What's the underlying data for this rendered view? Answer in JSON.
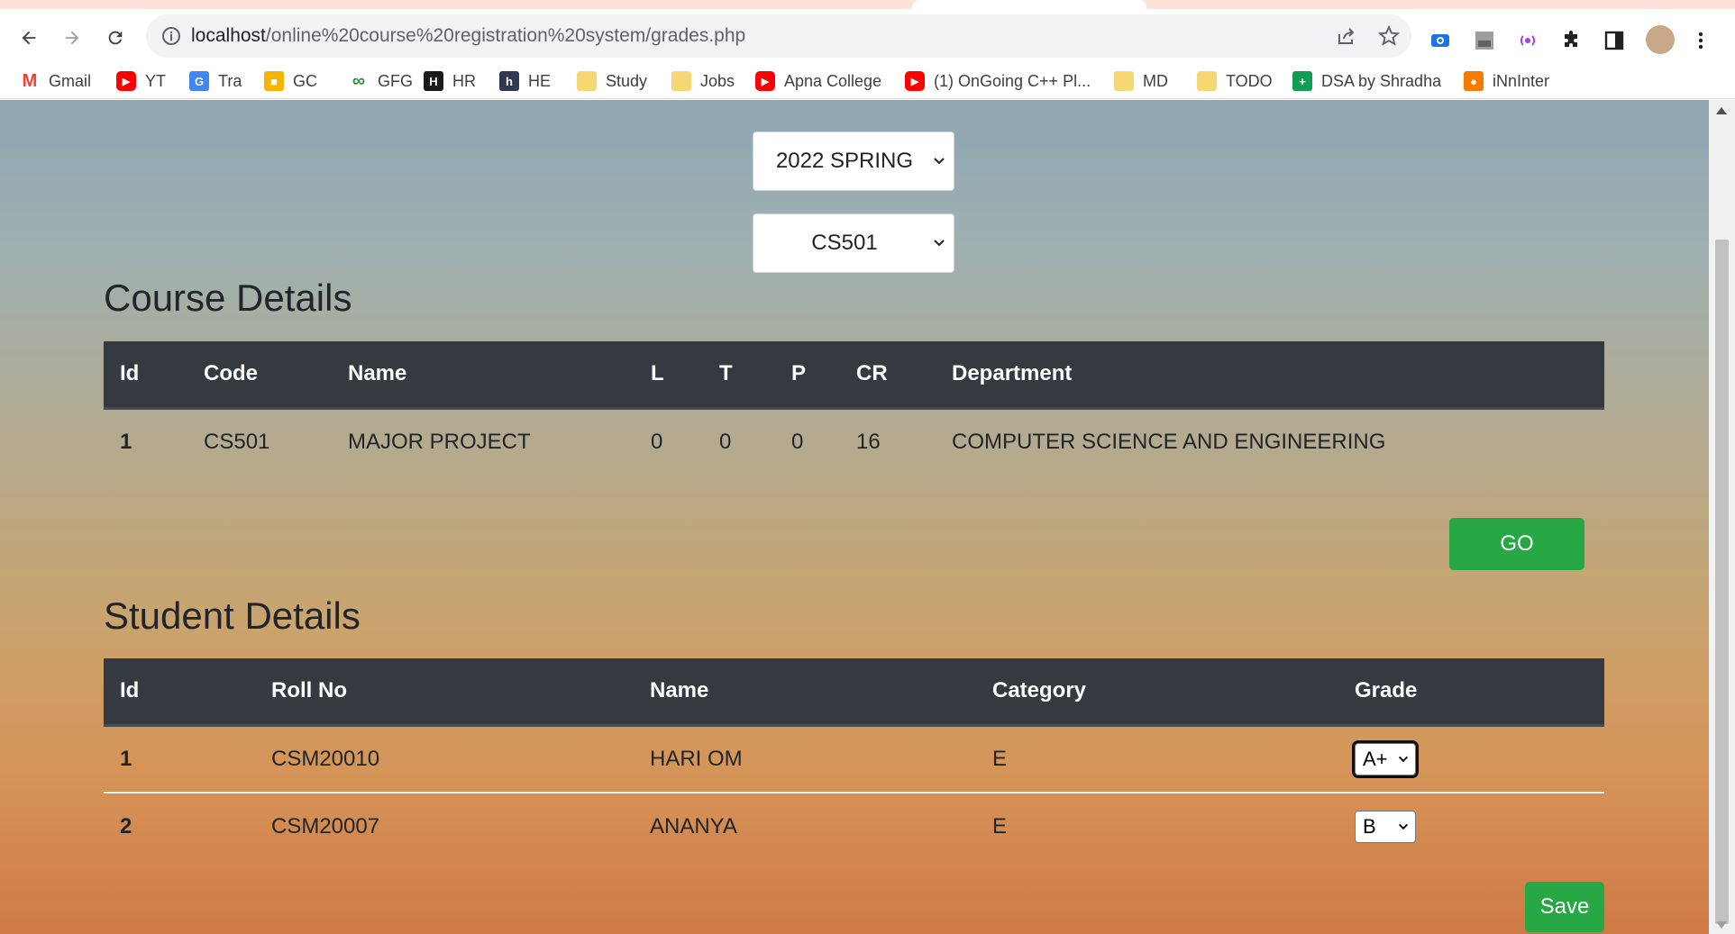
{
  "browser": {
    "url_host": "localhost",
    "url_path": "/online%20course%20registration%20system/grades.php",
    "bookmarks": [
      {
        "label": "Gmail",
        "icon": "gmail-icon",
        "color": "#ea4335"
      },
      {
        "label": "YT",
        "icon": "youtube-icon",
        "color": "#ff0000"
      },
      {
        "label": "Tra",
        "icon": "translate-icon",
        "color": "#4285f4"
      },
      {
        "label": "GC",
        "icon": "classroom-icon",
        "color": "#f4b400"
      },
      {
        "label": "GFG",
        "icon": "gfg-icon",
        "color": "#2f8d46"
      },
      {
        "label": "HR",
        "icon": "hackerrank-icon",
        "color": "#1a1a1a"
      },
      {
        "label": "HE",
        "icon": "hackerearth-icon",
        "color": "#323754"
      },
      {
        "label": "Study",
        "icon": "folder-icon",
        "color": "#f7d774"
      },
      {
        "label": "Jobs",
        "icon": "folder-icon",
        "color": "#f7d774"
      },
      {
        "label": "Apna College",
        "icon": "youtube-icon",
        "color": "#ff0000"
      },
      {
        "label": "(1) OnGoing C++ Pl...",
        "icon": "youtube-icon",
        "color": "#ff0000"
      },
      {
        "label": "MD",
        "icon": "folder-icon",
        "color": "#f7d774"
      },
      {
        "label": "TODO",
        "icon": "folder-icon",
        "color": "#f7d774"
      },
      {
        "label": "DSA by Shradha",
        "icon": "sheets-icon",
        "color": "#0f9d58"
      },
      {
        "label": "iNnInter",
        "icon": "innInter-icon",
        "color": "#f57c00"
      }
    ]
  },
  "filters": {
    "semester": "2022 SPRING",
    "course": "CS501"
  },
  "course_details": {
    "title": "Course Details",
    "headers": [
      "Id",
      "Code",
      "Name",
      "L",
      "T",
      "P",
      "CR",
      "Department"
    ],
    "rows": [
      [
        "1",
        "CS501",
        "MAJOR PROJECT",
        "0",
        "0",
        "0",
        "16",
        "COMPUTER SCIENCE AND ENGINEERING"
      ]
    ]
  },
  "go_button": "GO",
  "student_details": {
    "title": "Student Details",
    "headers": [
      "Id",
      "Roll No",
      "Name",
      "Category",
      "Grade"
    ],
    "rows": [
      {
        "id": "1",
        "roll": "CSM20010",
        "name": "HARI OM",
        "category": "E",
        "grade": "A+"
      },
      {
        "id": "2",
        "roll": "CSM20007",
        "name": "ANANYA",
        "category": "E",
        "grade": "B"
      }
    ]
  },
  "save_button": "Save",
  "colors": {
    "table_header": "#343a40",
    "button_green": "#28a745"
  }
}
